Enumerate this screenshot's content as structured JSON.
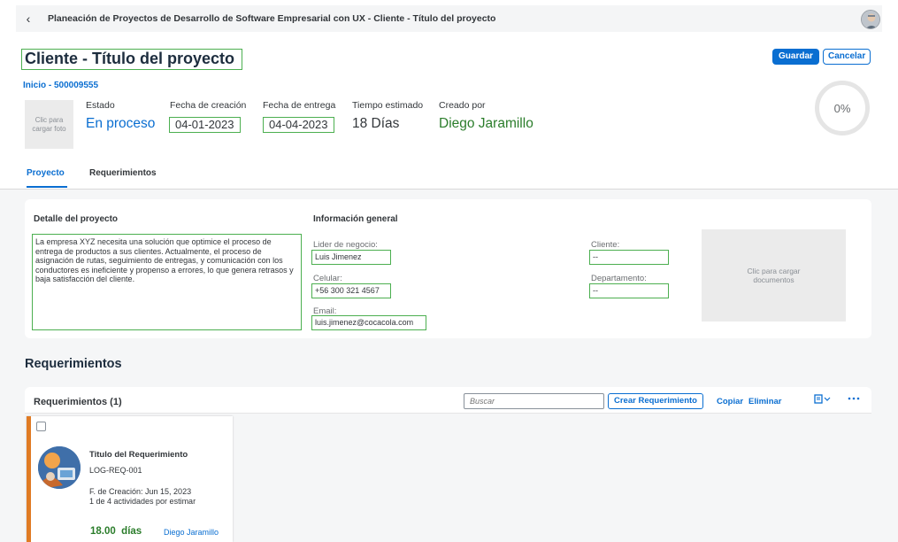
{
  "topbar": {
    "back_icon": "chevron-left-icon",
    "back_glyph": "‹",
    "title": "Planeación de Proyectos de Desarrollo de Software Empresarial con UX - Cliente - Título del proyecto"
  },
  "header": {
    "title": "Cliente - Título del proyecto",
    "breadcrumb": "Inicio - 500009555",
    "save_label": "Guardar",
    "cancel_label": "Cancelar",
    "photo_placeholder": "Clic para cargar foto",
    "fields": {
      "estado_label": "Estado",
      "estado_value": "En proceso",
      "fecha_creacion_label": "Fecha de creación",
      "fecha_creacion_value": "04-01-2023",
      "fecha_entrega_label": "Fecha de entrega",
      "fecha_entrega_value": "04-04-2023",
      "tiempo_label": "Tiempo estimado",
      "tiempo_value": "18 Días",
      "creado_label": "Creado por",
      "creado_value": "Diego Jaramillo"
    },
    "progress": {
      "value": 0,
      "label": "0%"
    }
  },
  "tabs": [
    {
      "label": "Proyecto",
      "active": true
    },
    {
      "label": "Requerimientos",
      "active": false
    }
  ],
  "detail": {
    "title": "Detalle del proyecto",
    "description": "La empresa XYZ necesita una solución que optimice el proceso de entrega de productos a sus clientes. Actualmente, el proceso de asignación de rutas, seguimiento de entregas, y comunicación con los conductores es ineficiente y propenso a errores, lo que genera retrasos y baja satisfacción del cliente."
  },
  "info": {
    "title": "Información general",
    "lider_label": "Lider de negocio:",
    "lider_value": "Luis Jimenez",
    "celular_label": "Celular:",
    "celular_value": "+56 300 321 4567",
    "email_label": "Email:",
    "email_value": "luis.jimenez@cocacola.com",
    "cliente_label": "Cliente:",
    "cliente_value": "--",
    "departamento_label": "Departamento:",
    "departamento_value": "--",
    "docs_placeholder": "Clic para cargar documentos"
  },
  "requirements": {
    "heading": "Requerimientos",
    "count_label": "Requerimientos (1)",
    "search_placeholder": "Buscar",
    "create_label": "Crear Requerimiento",
    "copy_label": "Copiar",
    "delete_label": "Eliminar",
    "view_icon": "view-settings-icon",
    "more_icon": "more-icon",
    "items": [
      {
        "title": "Titulo del Requerimiento",
        "code": "LOG-REQ-001",
        "created": "F. de Creación: Jun 15, 2023",
        "activities": "1 de 4 actividades por estimar",
        "days": "18.00  días",
        "owner": "Diego Jaramillo"
      }
    ]
  },
  "colors": {
    "accent": "#0a6ed1",
    "highlight_border": "#4caf50",
    "success_text": "#2b7d2b",
    "card_stripe": "#e07b24"
  }
}
